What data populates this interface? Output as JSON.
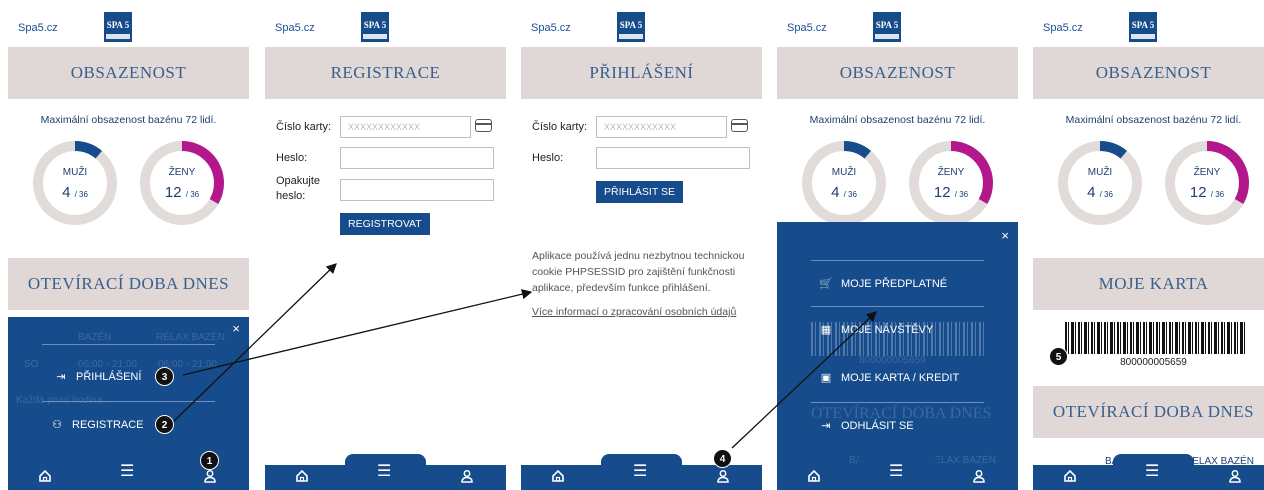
{
  "site_name": "Spa5.cz",
  "logo_text": "SPA 5",
  "colors": {
    "primary": "#164c8b",
    "band": "#dfd8d6",
    "men": "#164c8b",
    "women": "#b4178c",
    "track": "#e1dcd9"
  },
  "occupancy": {
    "title": "OBSAZENOST",
    "max_text": "Maximální obsazenost bazénu 72 lidí.",
    "men": {
      "label": "MUŽI",
      "count": "4",
      "of": "/ 36",
      "fraction": 0.111
    },
    "women": {
      "label": "ŽENY",
      "count": "12",
      "of": "/ 36",
      "fraction": 0.333
    }
  },
  "opening_title": "OTEVÍRACÍ DOBA DNES",
  "screen1": {
    "ghost_col1": "BAZÉN",
    "ghost_col2": "RELAX BAZÉN",
    "ghost_row": "SO",
    "ghost_time1": "06:00 - 21:00",
    "ghost_time2": "06:00 - 21:00",
    "ghost_note": "Každá první hodina ...",
    "menu_login": "PŘIHLÁŠENÍ",
    "menu_register": "REGISTRACE"
  },
  "registration": {
    "title": "REGISTRACE",
    "card_label": "Číslo karty:",
    "card_placeholder": "XXXXXXXXXXXX",
    "password_label": "Heslo:",
    "repeat_label_1": "Opakujte",
    "repeat_label_2": "heslo:",
    "submit": "REGISTROVAT"
  },
  "login": {
    "title": "PŘIHLÁŠENÍ",
    "card_label": "Číslo karty:",
    "card_placeholder": "XXXXXXXXXXXX",
    "password_label": "Heslo:",
    "submit": "PŘIHLÁSIT SE",
    "notice": "Aplikace používá jednu nezbytnou technickou cookie PHPSESSID pro zajištění funkčnosti aplikace, především funkce přihlášení.",
    "more_info": "Více informací o zpracování osobních údajů"
  },
  "user_menu": {
    "subscription": "MOJE PŘEDPLATNÉ",
    "visits": "MOJE NÁVŠTĚVY",
    "card_credit": "MOJE KARTA / KREDIT",
    "logout": "ODHLÁSIT SE",
    "ghost_number": "800000005659",
    "ghost_title": "OTEVÍRACÍ DOBA DNES",
    "ghost_col1": "BAZÉN",
    "ghost_col2": "RELAX BAZÉN"
  },
  "my_card": {
    "title": "MOJE KARTA",
    "number": "800000005659",
    "col1": "BAZÉN",
    "col2": "RELAX BAZÉN"
  },
  "badges": [
    "1",
    "2",
    "3",
    "4",
    "5"
  ],
  "close_symbol": "×"
}
